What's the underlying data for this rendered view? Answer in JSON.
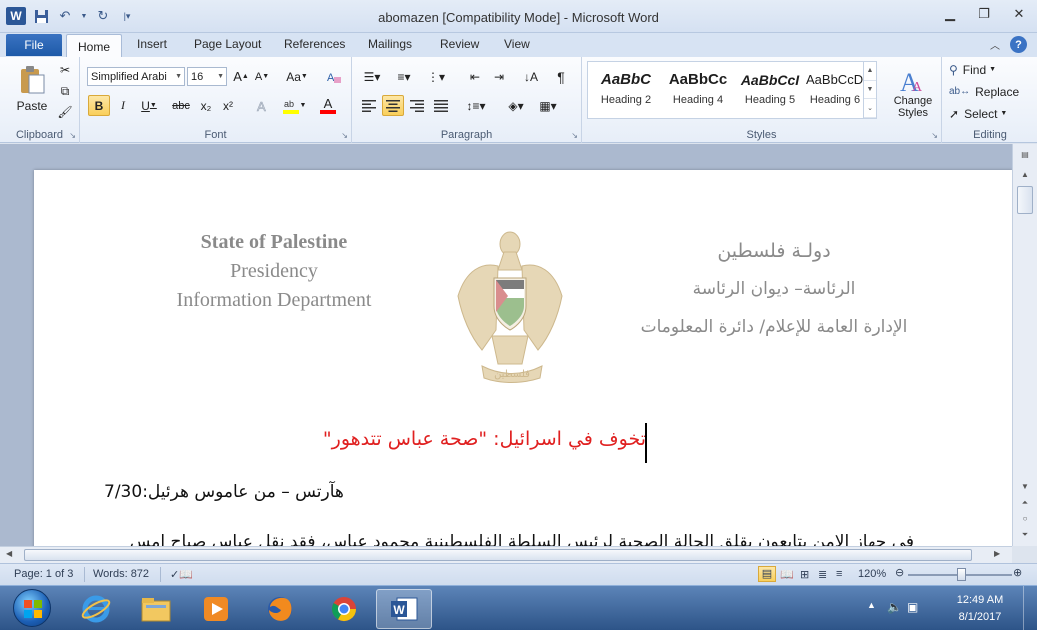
{
  "window": {
    "title": "abomazen [Compatibility Mode]  -  Microsoft Word",
    "app_icon_letter": "W"
  },
  "tabs": {
    "file": "File",
    "home": "Home",
    "insert": "Insert",
    "page_layout": "Page Layout",
    "references": "References",
    "mailings": "Mailings",
    "review": "Review",
    "view": "View"
  },
  "clipboard": {
    "label": "Clipboard",
    "paste": "Paste"
  },
  "font": {
    "label": "Font",
    "name": "Simplified Arabi",
    "size": "16",
    "bold": "B",
    "italic": "I",
    "underline": "U",
    "strike": "abc",
    "subscript": "x₂",
    "superscript": "x²",
    "grow": "A",
    "shrink": "A",
    "change_case": "Aa",
    "font_color": "A",
    "highlight_color": "#ffff00",
    "font_color_value": "#ff0000"
  },
  "paragraph": {
    "label": "Paragraph",
    "pilcrow": "¶"
  },
  "styles": {
    "label": "Styles",
    "items": [
      {
        "sample": "AaBbC",
        "name": "Heading 2"
      },
      {
        "sample": "AaBbCc",
        "name": "Heading 4"
      },
      {
        "sample": "AaBbCcI",
        "name": "Heading 5"
      },
      {
        "sample": "AaBbCcDc",
        "name": "Heading 6"
      }
    ],
    "change_styles": "Change Styles"
  },
  "editing": {
    "label": "Editing",
    "find": "Find",
    "replace": "Replace",
    "select": "Select"
  },
  "document": {
    "header_en": {
      "line1": "State of Palestine",
      "line2": "Presidency",
      "line3": "Information Department"
    },
    "header_ar": {
      "line1": "دولـة فلسطين",
      "line2": "الرئاسة– ديوان الرئاسة",
      "line3": "الإدارة العامة للإعلام/ دائرة المعلومات"
    },
    "emblem_text": "فلسطين",
    "title": "تخوف في اسرائيل: \"صحة عباس تتدهور\"",
    "byline": "هآرتس – من عاموس هرئيل:7/30",
    "body_first_line": "في جهاز الامن يتابعون بقلق الحالة الصحية لرئيس السلطة الفلسطينية محمود عباس، فقد نقل عباس صباح امس"
  },
  "status": {
    "page": "Page: 1 of 3",
    "words": "Words: 872",
    "zoom": "120%"
  },
  "taskbar": {
    "time": "12:49 AM",
    "date": "8/1/2017"
  }
}
